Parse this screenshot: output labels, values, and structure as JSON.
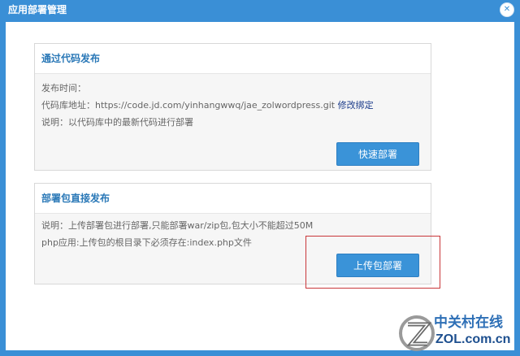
{
  "dialog": {
    "title": "应用部署管理",
    "close_symbol": "✕"
  },
  "code_deploy": {
    "title": "通过代码发布",
    "time_label": "发布时间：",
    "repo_label": "代码库地址：https://code.jd.com/yinhangwwq/jae_zolwordpress.git",
    "repo_link": "修改绑定",
    "note": "说明：以代码库中的最新代码进行部署",
    "button": "快速部署"
  },
  "package_deploy": {
    "title": "部署包直接发布",
    "note1": "说明：上传部署包进行部署,只能部署war/zip包,包大小不能超过50M",
    "note2": "php应用:上传包的根目录下必须存在:index.php文件",
    "button": "上传包部署"
  },
  "watermark": {
    "cn": "中关村在线",
    "en": "ZOL.com.cn"
  },
  "colors": {
    "accent": "#3a8fd6",
    "button": "#3a93d8",
    "highlight": "#c9373a"
  }
}
